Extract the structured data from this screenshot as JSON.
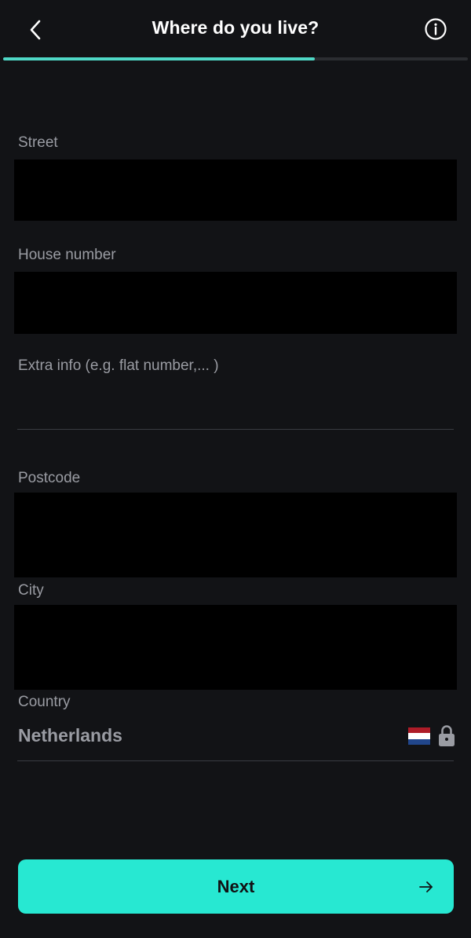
{
  "header": {
    "title": "Where do you live?",
    "progress_fraction": 0.67
  },
  "form": {
    "street_label": "Street",
    "house_number_label": "House number",
    "extra_info_placeholder": "Extra info (e.g. flat number,... )",
    "postcode_label": "Postcode",
    "city_label": "City",
    "country_label": "Country",
    "country_value": "Netherlands"
  },
  "actions": {
    "next_label": "Next"
  },
  "icons": {
    "back": "chevron-left-icon",
    "info": "info-circle-icon",
    "flag": "netherlands-flag-icon",
    "lock": "lock-icon",
    "next": "arrow-right-icon"
  },
  "colors": {
    "background": "#121316",
    "accent": "#27e8d2",
    "progress": "#4fd8c6",
    "label": "#9a9ca3",
    "flag_red": "#ae1c28",
    "flag_white": "#ffffff",
    "flag_blue": "#21468b"
  }
}
